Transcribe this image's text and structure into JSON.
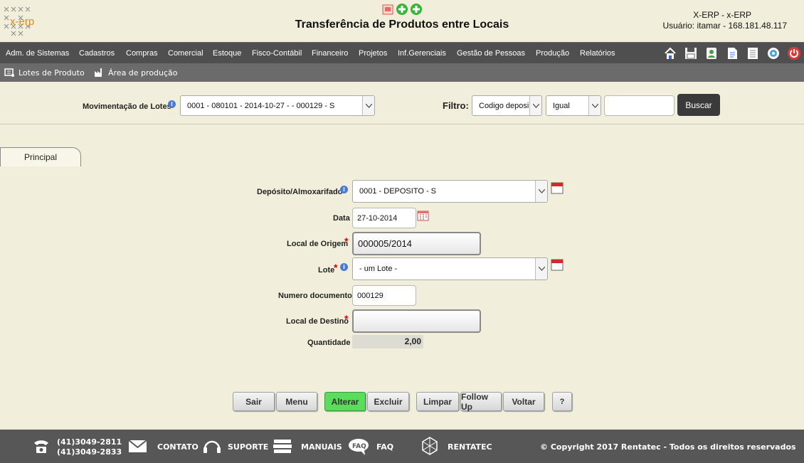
{
  "header": {
    "logo_text": "x-erp",
    "page_title": "Transferência de Produtos entre Locais",
    "system_name": "X-ERP - x-ERP",
    "user_line": "Usuário: itamar - 168.181.48.117"
  },
  "menu": {
    "items": [
      "Adm. de Sistemas",
      "Cadastros",
      "Compras",
      "Comercial",
      "Estoque",
      "Fisco-Contábil",
      "Financeiro",
      "Projetos",
      "Inf.Gerenciais",
      "Gestão de Pessoas",
      "Produção",
      "Relatórios"
    ],
    "toolbar_icons": [
      "home-icon",
      "save-icon",
      "user-badge-icon",
      "document-icon",
      "list-icon",
      "help-icon",
      "power-icon"
    ]
  },
  "submenu": {
    "items": [
      "Lotes de Produto",
      "Área de produção"
    ]
  },
  "filterbar": {
    "mov_label": "Movimentação de Lotes",
    "mov_value": "0001 - 080101 - 2014-10-27 - - 000129 - S",
    "filtro_label": "Filtro:",
    "filter_field": "Codigo deposito",
    "filter_op": "Igual",
    "filter_value": "",
    "search_button": "Buscar"
  },
  "tabs": {
    "principal": "Principal"
  },
  "form": {
    "deposito_label": "Depósito/Almoxarifado",
    "deposito_value": "0001 - DEPOSITO - S",
    "data_label": "Data",
    "data_value": "27-10-2014",
    "origem_label": "Local de Origem",
    "origem_value": "000005/2014",
    "lote_label": "Lote",
    "lote_value": "- um Lote -",
    "numdoc_label": "Numero documento",
    "numdoc_value": "000129",
    "destino_label": "Local de Destino",
    "destino_value": "",
    "quantidade_label": "Quantidade",
    "quantidade_value": "2,00",
    "required_mark": "*"
  },
  "buttons": {
    "sair": "Sair",
    "menu": "Menu",
    "alterar": "Alterar",
    "excluir": "Excluir",
    "limpar": "Limpar",
    "follow_up": "Follow Up",
    "voltar": "Voltar",
    "help": "?"
  },
  "footer": {
    "phone1": "(41)3049-2811",
    "phone2": "(41)3049-2833",
    "contato": "CONTATO",
    "suporte": "SUPORTE",
    "manuais": "MANUAIS",
    "faq": "FAQ",
    "rentatec": "RENTATEC",
    "copyright": "© Copyright 2017 Rentatec - Todos os direitos reservados"
  },
  "colors": {
    "background": "#f1efdb",
    "menubar": "#4f4f4f",
    "subbar": "#6b6b6b",
    "footer": "#575757",
    "alterar_button": "#5cdc5c",
    "required": "#dd0000"
  }
}
